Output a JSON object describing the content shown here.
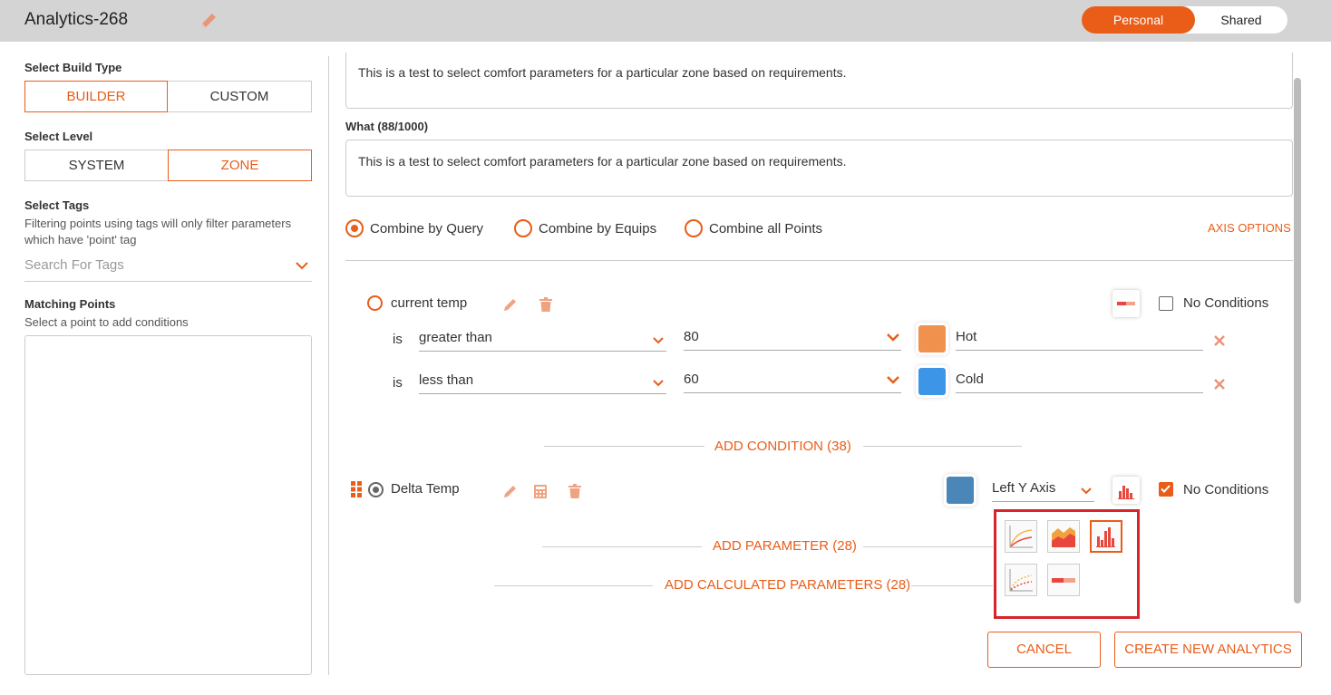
{
  "header": {
    "title": "Analytics-268",
    "toggle": {
      "personal": "Personal",
      "shared": "Shared"
    }
  },
  "sidebar": {
    "build_type_label": "Select Build Type",
    "build_types": [
      "BUILDER",
      "CUSTOM"
    ],
    "level_label": "Select Level",
    "levels": [
      "SYSTEM",
      "ZONE"
    ],
    "tags_label": "Select Tags",
    "tags_hint": "Filtering points using tags will only filter parameters which have 'point' tag",
    "tags_placeholder": "Search For Tags",
    "points_label": "Matching Points",
    "points_hint": "Select a point to add conditions"
  },
  "main": {
    "why_text": "This is a test to select comfort parameters for a particular zone based on requirements.",
    "what_label": "What (88/1000)",
    "what_text": "This is a test to select comfort parameters for a particular zone based on requirements.",
    "combine_options": [
      "Combine by Query",
      "Combine by Equips",
      "Combine all Points"
    ],
    "axis_options": "AXIS OPTIONS",
    "param1": {
      "name": "current temp",
      "no_conditions": "No Conditions",
      "conditions": [
        {
          "is": "is",
          "op": "greater than",
          "value": "80",
          "color": "#f0914e",
          "label": "Hot"
        },
        {
          "is": "is",
          "op": "less than",
          "value": "60",
          "color": "#3d95e8",
          "label": "Cold"
        }
      ]
    },
    "add_condition": "ADD CONDITION (38)",
    "param2": {
      "name": "Delta Temp",
      "color": "#4a86b8",
      "axis": "Left Y Axis",
      "no_conditions": "No Conditions"
    },
    "add_parameter": "ADD PARAMETER (28)",
    "add_calculated": "ADD CALCULATED PARAMETERS (28)",
    "chart_type_options": [
      "line-chart-icon",
      "area-chart-icon",
      "bar-chart-icon",
      "scatter-chart-icon",
      "heat-bar-icon"
    ],
    "cancel": "CANCEL",
    "create": "CREATE NEW ANALYTICS"
  }
}
